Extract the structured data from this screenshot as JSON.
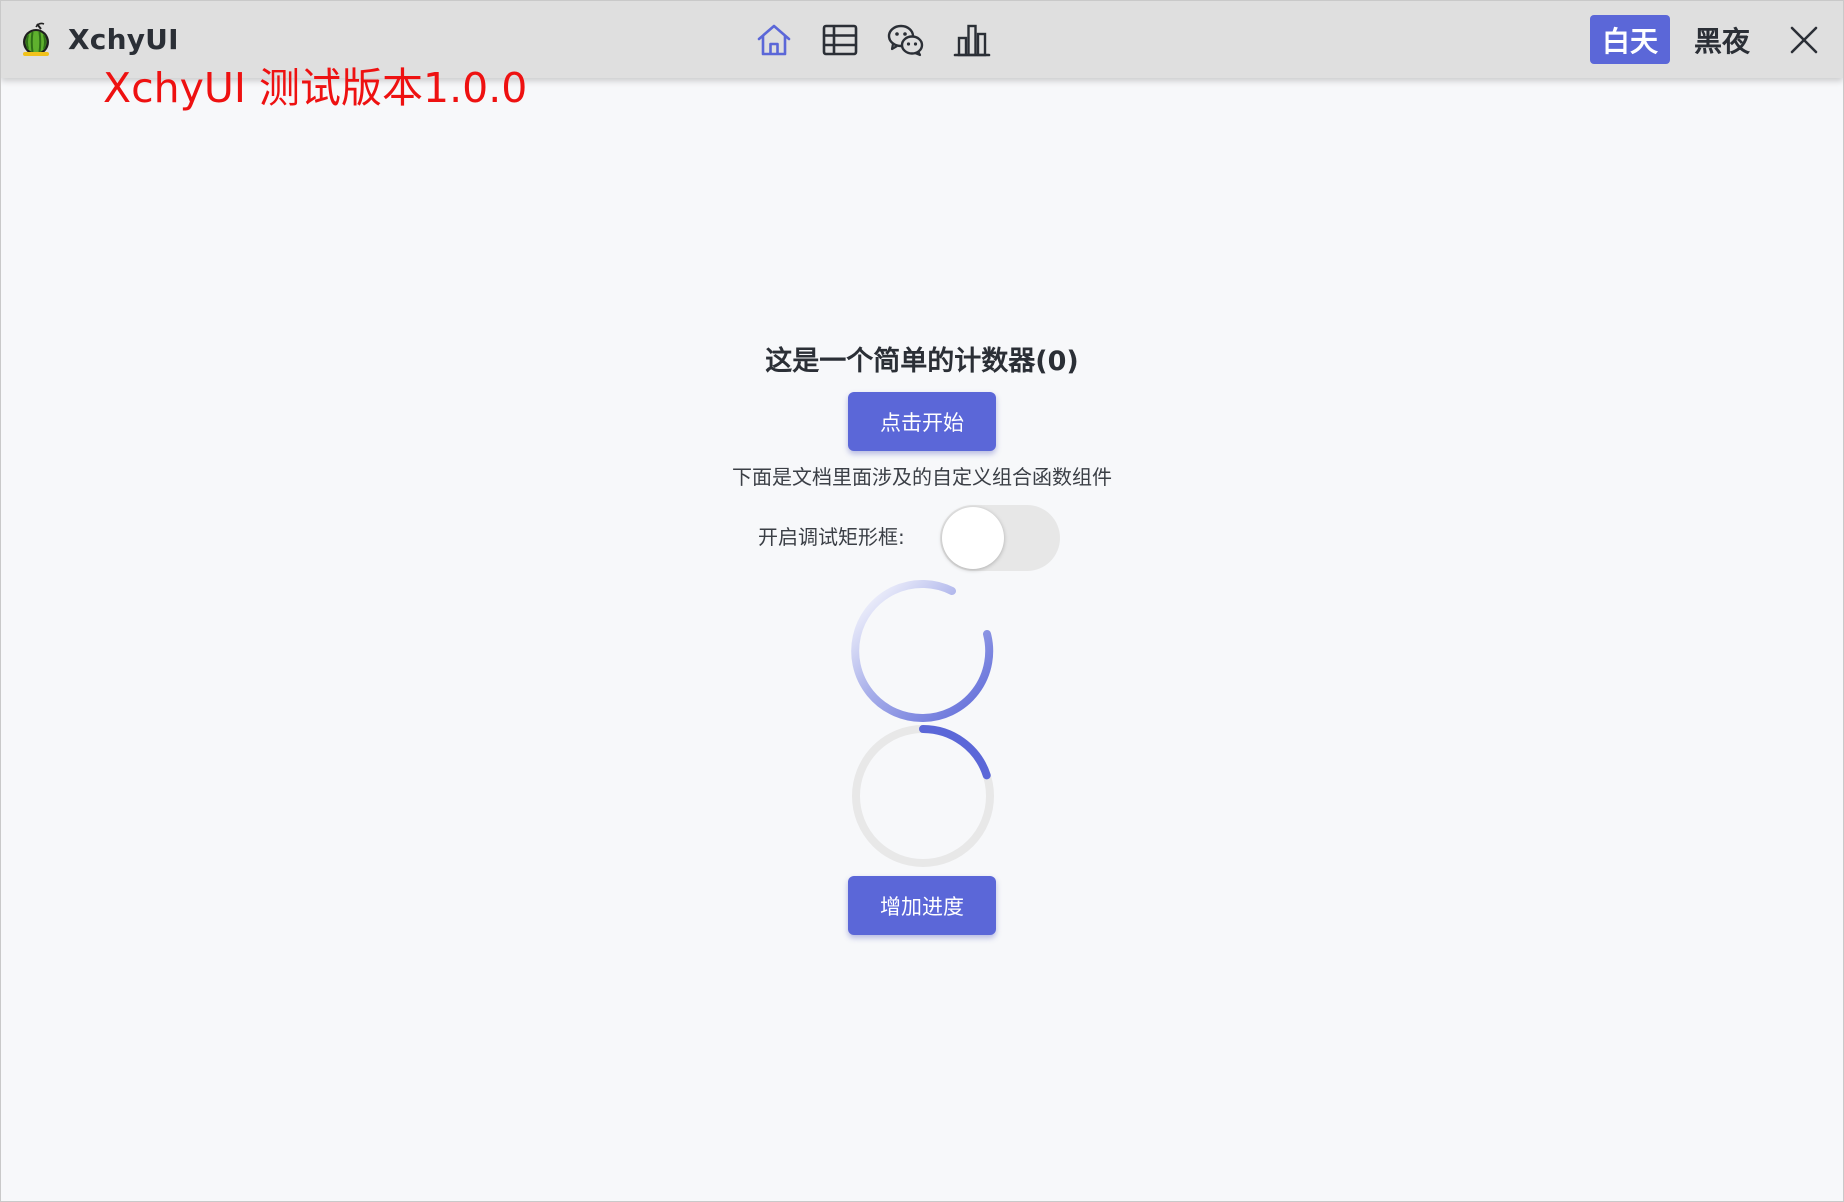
{
  "window": {
    "app_name": "XchyUI",
    "version_label": "XchyUI 测试版本1.0.0"
  },
  "nav": {
    "icons": [
      "home-icon",
      "table-icon",
      "wechat-icon",
      "bar-chart-icon"
    ],
    "active": "home-icon"
  },
  "theme": {
    "day_label": "白天",
    "night_label": "黑夜",
    "active": "day"
  },
  "counter": {
    "title": "这是一个简单的计数器(0)",
    "start_label": "点击开始"
  },
  "components": {
    "description": "下面是文档里面涉及的自定义组合函数组件",
    "debug_label": "开启调试矩形框:",
    "debug_enabled": false
  },
  "progress": {
    "value": 0.2,
    "button_label": "增加进度"
  },
  "colors": {
    "accent": "#5b67d8",
    "version_text": "#ee1111",
    "titlebar": "#dfdfdf",
    "background": "#f7f8fa"
  }
}
